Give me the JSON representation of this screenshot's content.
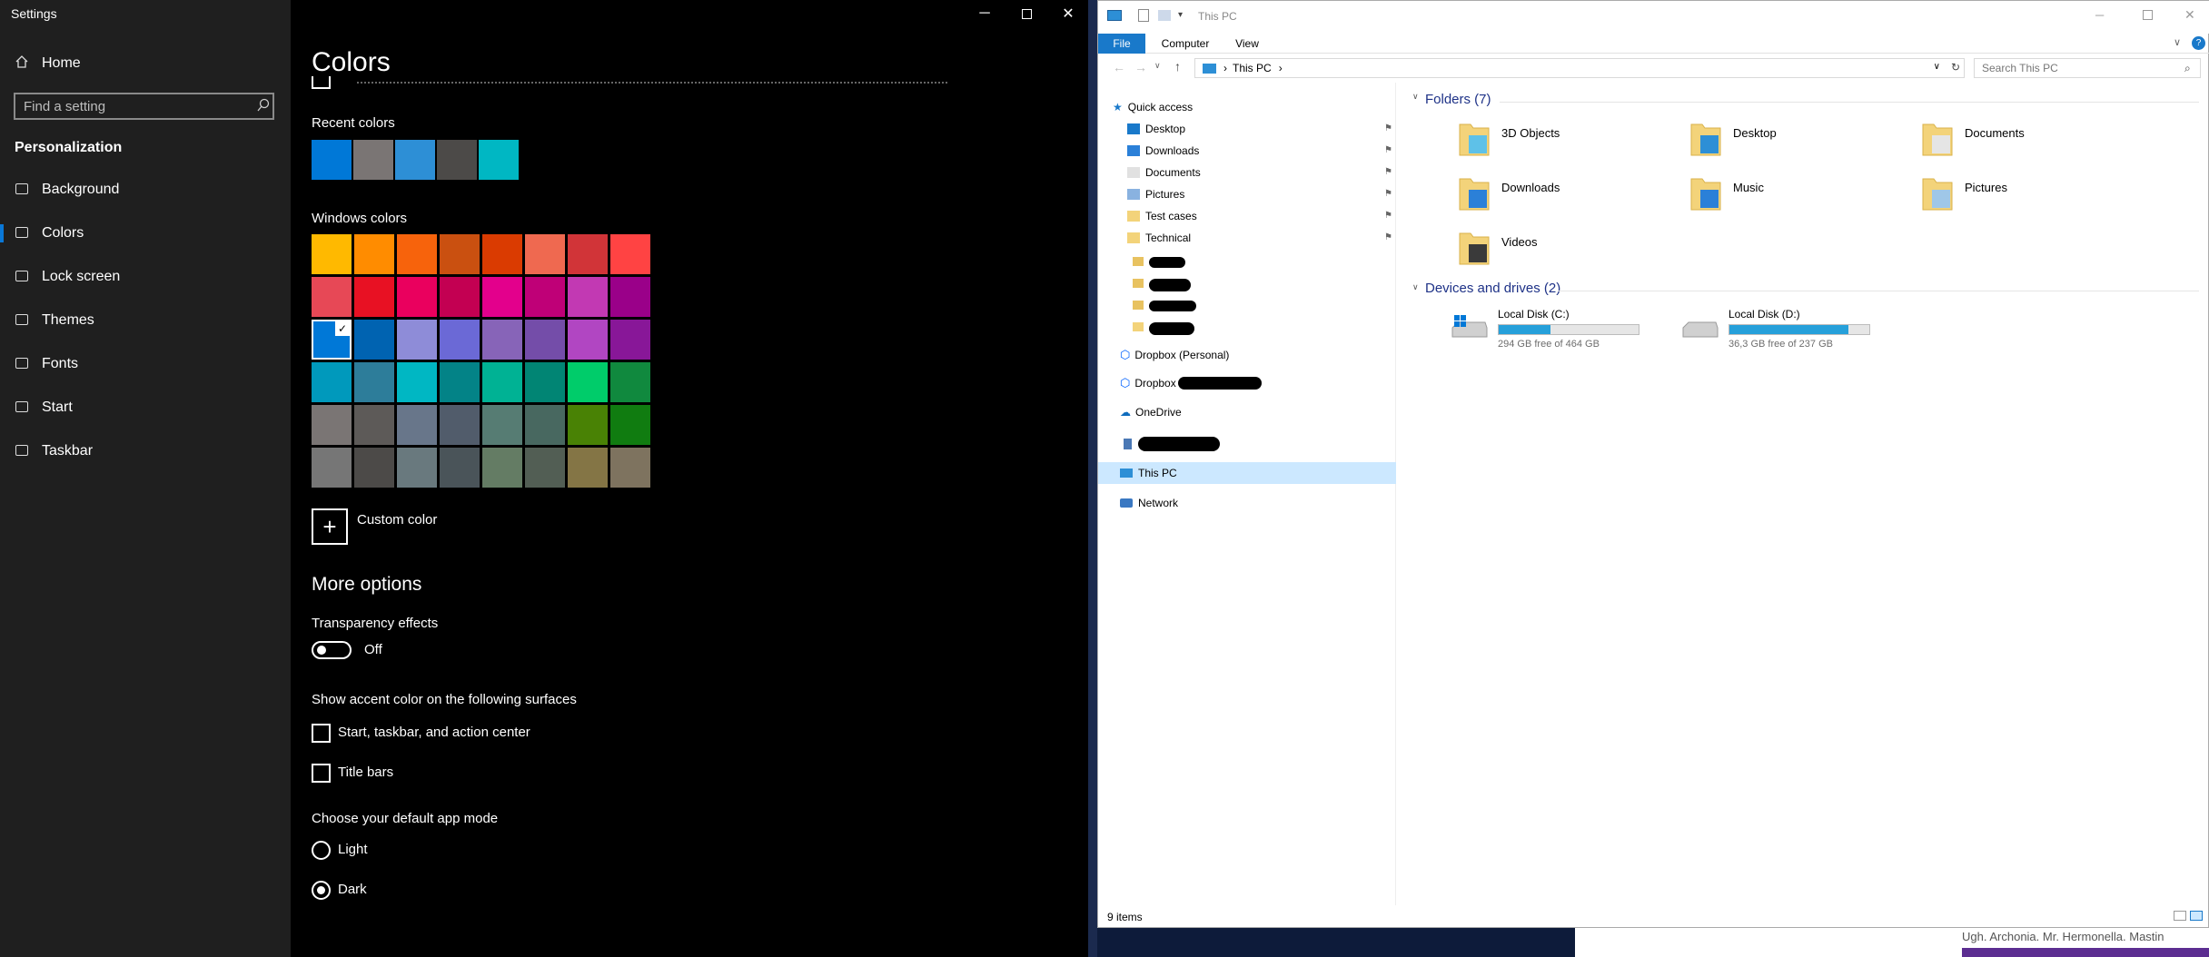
{
  "settings": {
    "window_title": "Settings",
    "nav": {
      "home": "Home",
      "search_placeholder": "Find a setting",
      "section": "Personalization",
      "items": [
        {
          "label": "Background",
          "icon": "image-icon"
        },
        {
          "label": "Colors",
          "icon": "palette-icon"
        },
        {
          "label": "Lock screen",
          "icon": "lock-screen-icon"
        },
        {
          "label": "Themes",
          "icon": "brush-icon"
        },
        {
          "label": "Fonts",
          "icon": "font-icon"
        },
        {
          "label": "Start",
          "icon": "start-icon"
        },
        {
          "label": "Taskbar",
          "icon": "taskbar-icon"
        }
      ],
      "active_index": 1
    },
    "main": {
      "title": "Colors",
      "recent_colors_label": "Recent colors",
      "recent_colors": [
        "#0078d7",
        "#7a7574",
        "#2d8fd6",
        "#4c4a48",
        "#00b7c3"
      ],
      "windows_colors_label": "Windows colors",
      "windows_colors": [
        [
          "#ffb900",
          "#ff8c00",
          "#f7630c",
          "#ca5010",
          "#da3b01",
          "#ef6950",
          "#d13438",
          "#ff4343"
        ],
        [
          "#e74856",
          "#e81123",
          "#ea005e",
          "#c30052",
          "#e3008c",
          "#bf0077",
          "#c239b3",
          "#9a0089"
        ],
        [
          "#0078d7",
          "#0063b1",
          "#8e8cd8",
          "#6b69d6",
          "#8764b8",
          "#744da9",
          "#b146c2",
          "#881798"
        ],
        [
          "#0099bc",
          "#2d7d9a",
          "#00b7c3",
          "#038387",
          "#00b294",
          "#018574",
          "#00cc6a",
          "#10893e"
        ],
        [
          "#7a7574",
          "#5d5a58",
          "#68768a",
          "#515c6b",
          "#567c73",
          "#486860",
          "#498205",
          "#107c10"
        ],
        [
          "#767676",
          "#4c4a48",
          "#69797e",
          "#4a5459",
          "#647c64",
          "#525e54",
          "#847545",
          "#7e735f"
        ]
      ],
      "selected_color": "#0078d7",
      "custom_color_label": "Custom color",
      "more_options": "More options",
      "transparency_label": "Transparency effects",
      "transparency_state": "Off",
      "accent_surfaces_label": "Show accent color on the following surfaces",
      "checkbox_start": "Start, taskbar, and action center",
      "checkbox_titlebars": "Title bars",
      "app_mode_label": "Choose your default app mode",
      "radio_light": "Light",
      "radio_dark": "Dark",
      "app_mode_selected": "Dark"
    }
  },
  "explorer": {
    "title": "This PC",
    "tabs": [
      "File",
      "Computer",
      "View"
    ],
    "address_path": "This PC",
    "search_placeholder": "Search This PC",
    "quick_access": "Quick access",
    "quick_items": [
      "Desktop",
      "Downloads",
      "Documents",
      "Pictures",
      "Test cases",
      "Technical"
    ],
    "dropbox_personal": "Dropbox (Personal)",
    "dropbox_other": "Dropbox",
    "onedrive": "OneDrive",
    "this_pc": "This PC",
    "network": "Network",
    "folders_header": "Folders (7)",
    "folders": [
      "3D Objects",
      "Desktop",
      "Documents",
      "Downloads",
      "Music",
      "Pictures",
      "Videos"
    ],
    "drives_header": "Devices and drives (2)",
    "drives": [
      {
        "name": "Local Disk (C:)",
        "free": "294 GB free of 464 GB",
        "used_fraction": 0.37
      },
      {
        "name": "Local Disk (D:)",
        "free": "36,3 GB free of 237 GB",
        "used_fraction": 0.85
      }
    ],
    "status": "9 items"
  },
  "background_window": {
    "text": "Ugh. Archonia. Mr. Hermonella. Mastin"
  }
}
